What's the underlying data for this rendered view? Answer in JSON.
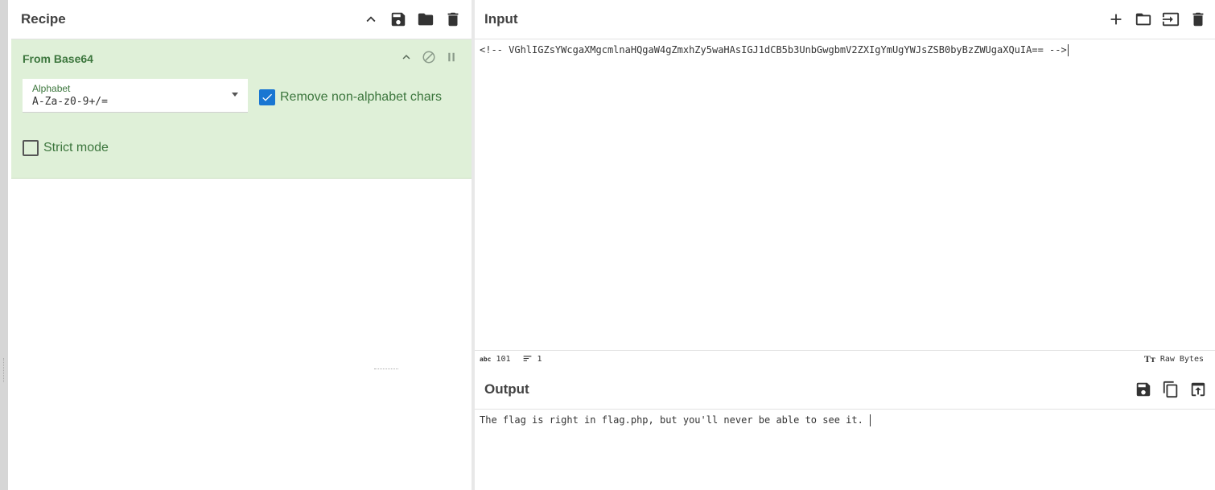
{
  "recipe": {
    "title": "Recipe",
    "operation": {
      "name": "From Base64",
      "alphabet_label": "Alphabet",
      "alphabet_value": "A-Za-z0-9+/=",
      "remove_label": "Remove non-alphabet chars",
      "remove_checked": true,
      "strict_label": "Strict mode",
      "strict_checked": false
    }
  },
  "input": {
    "title": "Input",
    "text": "<!-- VGhlIGZsYWcgaXMgcmlnaHQgaW4gZmxhZy5waHAsIGJ1dCB5b3UnbGwgbmV2ZXIgYmUgYWJsZSB0byBzZWUgaXQuIA== -->",
    "char_count_icon": "abc",
    "char_count": "101",
    "line_count": "1",
    "encoding": "Raw Bytes"
  },
  "output": {
    "title": "Output",
    "text": "The flag is right in flag.php, but you'll never be able to see it. "
  },
  "colors": {
    "operation_bg": "#dff0d8",
    "operation_text": "#3c763d",
    "checkbox_on": "#1976d2"
  }
}
